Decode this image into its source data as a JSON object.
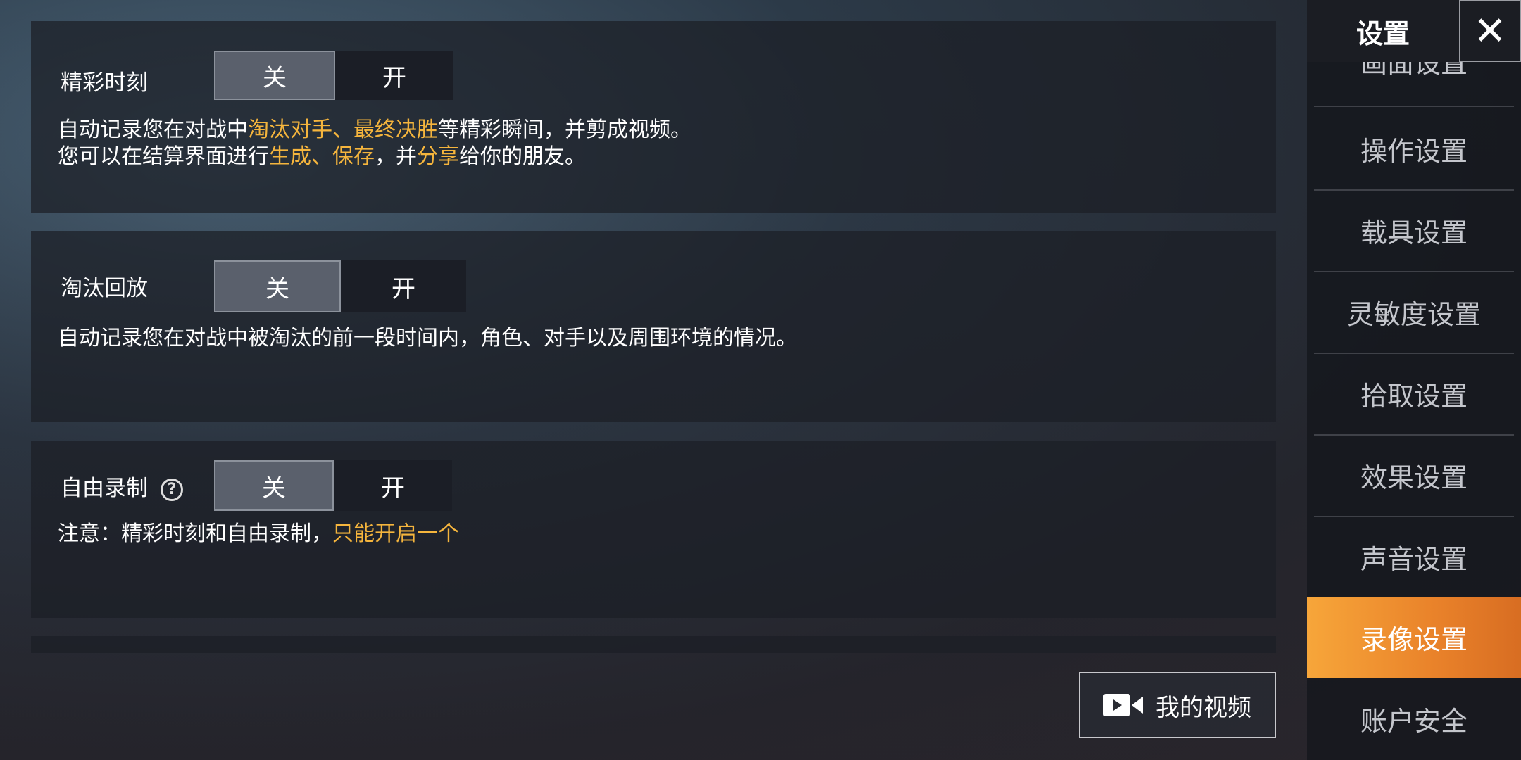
{
  "sidebar": {
    "title": "设置",
    "close_icon": "✕",
    "items": [
      {
        "label": "画面设置"
      },
      {
        "label": "操作设置"
      },
      {
        "label": "载具设置"
      },
      {
        "label": "灵敏度设置"
      },
      {
        "label": "拾取设置"
      },
      {
        "label": "效果设置"
      },
      {
        "label": "声音设置"
      },
      {
        "label": "录像设置",
        "active": true
      },
      {
        "label": "账户安全"
      }
    ]
  },
  "highlight": {
    "label": "精彩时刻",
    "off": "关",
    "on": "开",
    "selected": "关",
    "desc1_a": "自动记录您在对战中",
    "desc1_b": "淘汰对手、最终决胜",
    "desc1_c": "等精彩瞬间，并剪成视频。",
    "desc2_a": "您可以在结算界面进行",
    "desc2_b": "生成、保存",
    "desc2_c": "，并",
    "desc2_d": "分享",
    "desc2_e": "给你的朋友。"
  },
  "elimination": {
    "label": "淘汰回放",
    "off": "关",
    "on": "开",
    "selected": "关",
    "desc": "自动记录您在对战中被淘汰的前一段时间内，角色、对手以及周围环境的情况。"
  },
  "free_record": {
    "label": "自由录制",
    "help_icon": "?",
    "off": "关",
    "on": "开",
    "selected": "关",
    "note_a": "注意：精彩时刻和自由录制，",
    "note_b": "只能开启一个"
  },
  "my_video_button": "我的视频",
  "colors": {
    "accent": "#f5b53d",
    "active_tab": "#eb8a2c"
  }
}
